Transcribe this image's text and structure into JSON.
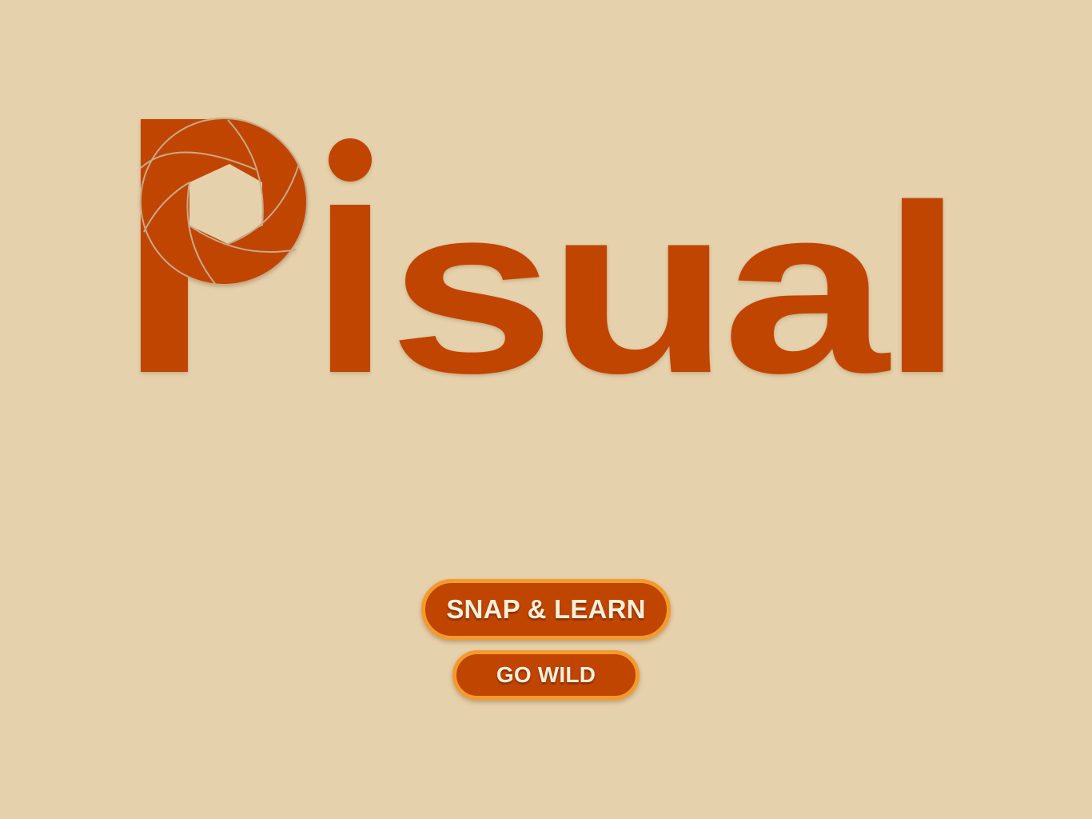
{
  "app": {
    "logo_text": "Pisual",
    "brand_color": "#C04501",
    "background_color": "#E5D1AC",
    "button_border_color": "#F39A2C",
    "logo_icon": "camera-aperture-icon"
  },
  "actions": {
    "snap_learn_label": "SNAP & LEARN",
    "go_wild_label": "GO WILD"
  }
}
